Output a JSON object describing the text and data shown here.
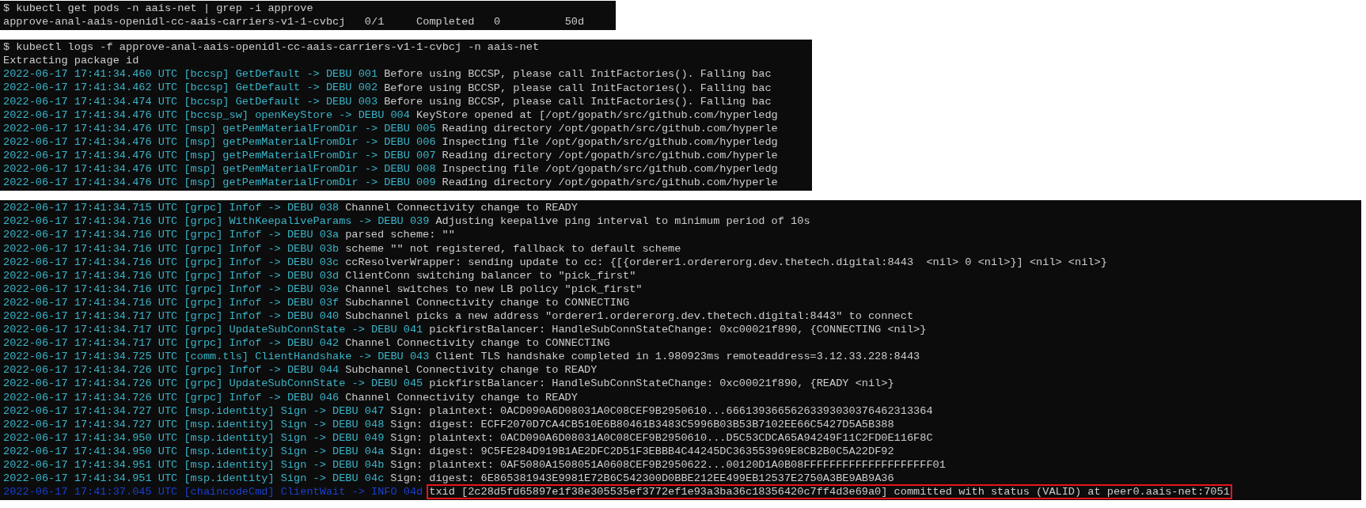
{
  "windows": [
    {
      "lines": [
        {
          "kind": "command",
          "text": "$ kubectl get pods -n aais-net | grep -i approve",
          "highlighted": false
        },
        {
          "kind": "output",
          "text": "approve-anal-aais-openidl-cc-aais-carriers-v1-1-cvbcj   0/1     Completed   0          50d",
          "highlighted": false
        }
      ]
    },
    {
      "lines": [
        {
          "kind": "command",
          "text": "$ kubectl logs -f approve-anal-aais-openidl-cc-aais-carriers-v1-1-cvbcj -n aais-net",
          "highlighted": false
        },
        {
          "kind": "output",
          "text": "Extracting package id",
          "highlighted": false
        },
        {
          "kind": "debug",
          "prefix": "2022-06-17 17:41:34.460 UTC [bccsp] GetDefault -> DEBU 001",
          "text": "Before using BCCSP, please call InitFactories(). Falling bac",
          "highlighted": false
        },
        {
          "kind": "debug",
          "prefix": "2022-06-17 17:41:34.462 UTC [bccsp] GetDefault -> DEBU 002",
          "text": "Before using BCCSP, please call InitFactories(). Falling bac",
          "highlighted": false
        },
        {
          "kind": "debug",
          "prefix": "2022-06-17 17:41:34.474 UTC [bccsp] GetDefault -> DEBU 003",
          "text": "Before using BCCSP, please call InitFactories(). Falling bac",
          "highlighted": false
        },
        {
          "kind": "debug",
          "prefix": "2022-06-17 17:41:34.476 UTC [bccsp_sw] openKeyStore -> DEBU 004",
          "text": "KeyStore opened at [/opt/gopath/src/github.com/hyperledg",
          "highlighted": false
        },
        {
          "kind": "debug",
          "prefix": "2022-06-17 17:41:34.476 UTC [msp] getPemMaterialFromDir -> DEBU 005",
          "text": "Reading directory /opt/gopath/src/github.com/hyperle",
          "highlighted": false
        },
        {
          "kind": "debug",
          "prefix": "2022-06-17 17:41:34.476 UTC [msp] getPemMaterialFromDir -> DEBU 006",
          "text": "Inspecting file /opt/gopath/src/github.com/hyperledg",
          "highlighted": false
        },
        {
          "kind": "debug",
          "prefix": "2022-06-17 17:41:34.476 UTC [msp] getPemMaterialFromDir -> DEBU 007",
          "text": "Reading directory /opt/gopath/src/github.com/hyperle",
          "highlighted": false
        },
        {
          "kind": "debug",
          "prefix": "2022-06-17 17:41:34.476 UTC [msp] getPemMaterialFromDir -> DEBU 008",
          "text": "Inspecting file /opt/gopath/src/github.com/hyperledg",
          "highlighted": false
        },
        {
          "kind": "debug",
          "prefix": "2022-06-17 17:41:34.476 UTC [msp] getPemMaterialFromDir -> DEBU 009",
          "text": "Reading directory /opt/gopath/src/github.com/hyperle",
          "highlighted": false
        }
      ]
    },
    {
      "lines": [
        {
          "kind": "debug",
          "prefix": "2022-06-17 17:41:34.715 UTC [grpc] Infof -> DEBU 038",
          "text": "Channel Connectivity change to READY",
          "highlighted": false
        },
        {
          "kind": "debug",
          "prefix": "2022-06-17 17:41:34.716 UTC [grpc] WithKeepaliveParams -> DEBU 039",
          "text": "Adjusting keepalive ping interval to minimum period of 10s",
          "highlighted": false
        },
        {
          "kind": "debug",
          "prefix": "2022-06-17 17:41:34.716 UTC [grpc] Infof -> DEBU 03a",
          "text": "parsed scheme: \"\"",
          "highlighted": false
        },
        {
          "kind": "debug",
          "prefix": "2022-06-17 17:41:34.716 UTC [grpc] Infof -> DEBU 03b",
          "text": "scheme \"\" not registered, fallback to default scheme",
          "highlighted": false
        },
        {
          "kind": "debug",
          "prefix": "2022-06-17 17:41:34.716 UTC [grpc] Infof -> DEBU 03c",
          "text": "ccResolverWrapper: sending update to cc: {[{orderer1.ordererorg.dev.thetech.digital:8443  <nil> 0 <nil>}] <nil> <nil>}",
          "highlighted": false
        },
        {
          "kind": "debug",
          "prefix": "2022-06-17 17:41:34.716 UTC [grpc] Infof -> DEBU 03d",
          "text": "ClientConn switching balancer to \"pick_first\"",
          "highlighted": false
        },
        {
          "kind": "debug",
          "prefix": "2022-06-17 17:41:34.716 UTC [grpc] Infof -> DEBU 03e",
          "text": "Channel switches to new LB policy \"pick_first\"",
          "highlighted": false
        },
        {
          "kind": "debug",
          "prefix": "2022-06-17 17:41:34.716 UTC [grpc] Infof -> DEBU 03f",
          "text": "Subchannel Connectivity change to CONNECTING",
          "highlighted": false
        },
        {
          "kind": "debug",
          "prefix": "2022-06-17 17:41:34.717 UTC [grpc] Infof -> DEBU 040",
          "text": "Subchannel picks a new address \"orderer1.ordererorg.dev.thetech.digital:8443\" to connect",
          "highlighted": false
        },
        {
          "kind": "debug",
          "prefix": "2022-06-17 17:41:34.717 UTC [grpc] UpdateSubConnState -> DEBU 041",
          "text": "pickfirstBalancer: HandleSubConnStateChange: 0xc00021f890, {CONNECTING <nil>}",
          "highlighted": false
        },
        {
          "kind": "debug",
          "prefix": "2022-06-17 17:41:34.717 UTC [grpc] Infof -> DEBU 042",
          "text": "Channel Connectivity change to CONNECTING",
          "highlighted": false
        },
        {
          "kind": "debug",
          "prefix": "2022-06-17 17:41:34.725 UTC [comm.tls] ClientHandshake -> DEBU 043",
          "text": "Client TLS handshake completed in 1.980923ms remoteaddress=3.12.33.228:8443",
          "highlighted": false
        },
        {
          "kind": "debug",
          "prefix": "2022-06-17 17:41:34.726 UTC [grpc] Infof -> DEBU 044",
          "text": "Subchannel Connectivity change to READY",
          "highlighted": false
        },
        {
          "kind": "debug",
          "prefix": "2022-06-17 17:41:34.726 UTC [grpc] UpdateSubConnState -> DEBU 045",
          "text": "pickfirstBalancer: HandleSubConnStateChange: 0xc00021f890, {READY <nil>}",
          "highlighted": false
        },
        {
          "kind": "debug",
          "prefix": "2022-06-17 17:41:34.726 UTC [grpc] Infof -> DEBU 046",
          "text": "Channel Connectivity change to READY",
          "highlighted": false
        },
        {
          "kind": "debug",
          "prefix": "2022-06-17 17:41:34.727 UTC [msp.identity] Sign -> DEBU 047",
          "text": "Sign: plaintext: 0ACD090A6D08031A0C08CEF9B2950610...66613936656263393030376462313364",
          "highlighted": false
        },
        {
          "kind": "debug",
          "prefix": "2022-06-17 17:41:34.727 UTC [msp.identity] Sign -> DEBU 048",
          "text": "Sign: digest: ECFF2070D7CA4CB510E6B80461B3483C5996B03B53B7102EE66C5427D5A5B388",
          "highlighted": false
        },
        {
          "kind": "debug",
          "prefix": "2022-06-17 17:41:34.950 UTC [msp.identity] Sign -> DEBU 049",
          "text": "Sign: plaintext: 0ACD090A6D08031A0C08CEF9B2950610...D5C53CDCA65A94249F11C2FD0E116F8C",
          "highlighted": false
        },
        {
          "kind": "debug",
          "prefix": "2022-06-17 17:41:34.950 UTC [msp.identity] Sign -> DEBU 04a",
          "text": "Sign: digest: 9C5FE284D919B1AE2DFC2D51F3EBBB4C44245DC363553969E8CB2B0C5A22DF92",
          "highlighted": false
        },
        {
          "kind": "debug",
          "prefix": "2022-06-17 17:41:34.951 UTC [msp.identity] Sign -> DEBU 04b",
          "text": "Sign: plaintext: 0AF5080A1508051A0608CEF9B2950622...00120D1A0B08FFFFFFFFFFFFFFFFFFFF01",
          "highlighted": false
        },
        {
          "kind": "debug",
          "prefix": "2022-06-17 17:41:34.951 UTC [msp.identity] Sign -> DEBU 04c",
          "text": "Sign: digest: 6E865381943E9981E72B6C542300D0BBE212EE499EB12537E2750A3BE9AB9A36",
          "highlighted": false
        },
        {
          "kind": "info",
          "prefix": "2022-06-17 17:41:37.045 UTC [chaincodeCmd] ClientWait -> INFO 04d",
          "text": "txid [2c28d5fd65897e1f38e305535ef3772ef1e93a3ba36c18356420c7ff4d3e69a0] committed with status (VALID) at peer0.aais-net:7051",
          "highlighted": true
        }
      ]
    }
  ]
}
